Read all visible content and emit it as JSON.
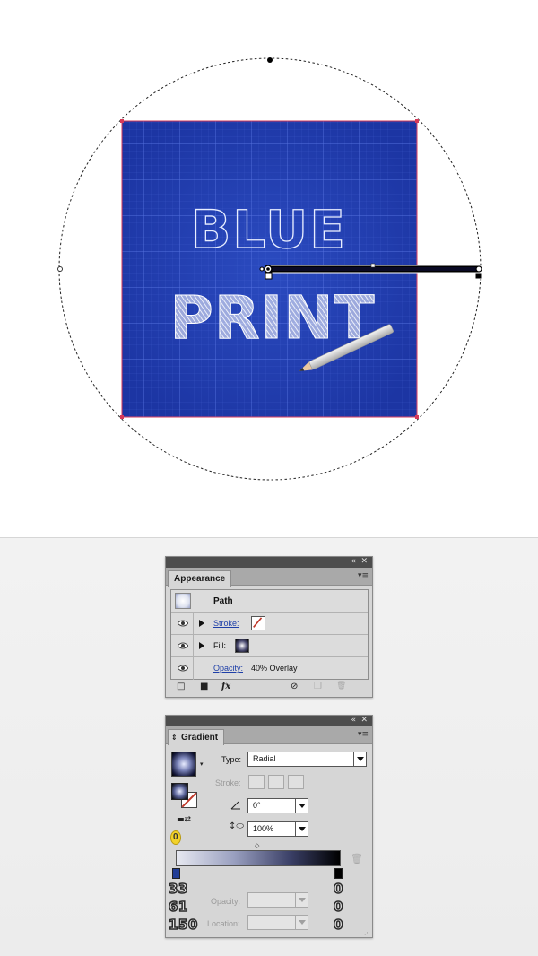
{
  "artwork": {
    "line1": "BLUE",
    "line2": "PRINT"
  },
  "appearance_panel": {
    "collapse_glyph": "«",
    "close_glyph": "✕",
    "tab_label": "Appearance",
    "menu_glyph": "▾≡",
    "object_label": "Path",
    "rows": {
      "stroke_label": "Stroke:",
      "fill_label": "Fill:",
      "opacity_label": "Opacity:",
      "opacity_value": "40% Overlay"
    },
    "footer": {
      "add_stroke_icon": "□",
      "add_fill_icon": "■",
      "fx_label": "fx",
      "clear_icon": "⊘",
      "duplicate_icon": "❐",
      "delete_icon": "🗑"
    },
    "colors": {
      "link": "#1e3fa8",
      "stroke_swatch": "#c0392b"
    }
  },
  "gradient_panel": {
    "collapse_glyph": "«",
    "close_glyph": "✕",
    "tab_label": "Gradient",
    "menu_glyph": "▾≡",
    "type_label": "Type:",
    "type_value": "Radial",
    "stroke_label": "Stroke:",
    "angle_value": "0°",
    "aspect_value": "100%",
    "opacity_label": "Opacity:",
    "location_label": "Location:",
    "stop_number": "0",
    "left_stop_values": [
      "33",
      "61",
      "150"
    ],
    "right_stop_values": [
      "0",
      "0",
      "0"
    ],
    "colors": {
      "left_stop": "#213d96",
      "right_stop": "#000000",
      "marker_highlight": "#f2d22a"
    }
  }
}
